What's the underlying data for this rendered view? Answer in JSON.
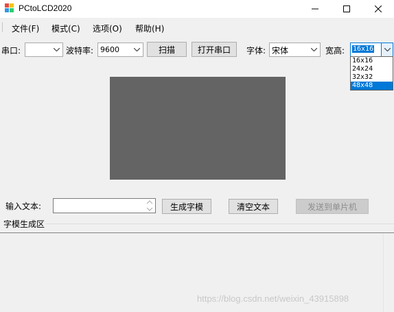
{
  "window": {
    "title": "PCtoLCD2020"
  },
  "menu": {
    "items": [
      "文件(F)",
      "模式(C)",
      "选项(O)",
      "帮助(H)"
    ]
  },
  "toolbar": {
    "port_label": "串口:",
    "port_value": "",
    "baud_label": "波特率:",
    "baud_value": "9600",
    "scan_label": "扫描",
    "open_port_label": "打开串口",
    "font_label": "字体:",
    "font_value": "宋体",
    "size_label": "宽高:",
    "size_value": "16x16"
  },
  "size_dropdown": {
    "options": [
      "16x16",
      "24x24",
      "32x32",
      "48x48"
    ],
    "highlighted": "48x48"
  },
  "input_row": {
    "input_label": "输入文本:",
    "input_value": "",
    "generate_label": "生成字模",
    "clear_label": "清空文本",
    "send_label": "发送到单片机"
  },
  "output": {
    "group_label": "字模生成区",
    "content": ""
  },
  "watermark": "https://blog.csdn.net/weixin_43915898",
  "colors": {
    "preview_bg": "#646464",
    "selection": "#0078d7",
    "window_bg": "#f0f0f0"
  },
  "icons": [
    "app-icon",
    "minimize-icon",
    "maximize-icon",
    "close-icon",
    "dropdown-arrow-icon",
    "spin-up-icon",
    "spin-down-icon"
  ]
}
